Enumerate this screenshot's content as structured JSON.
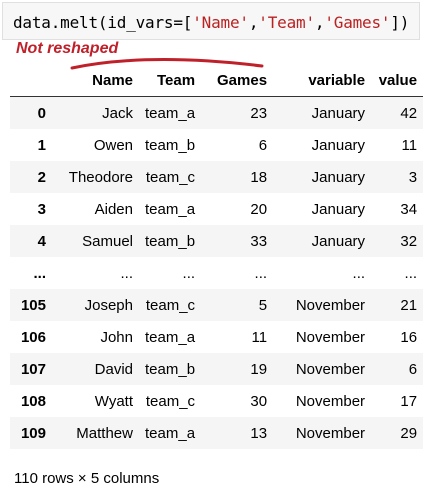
{
  "code": {
    "prefix": "data.melt(id_vars=[",
    "arg1": "'Name'",
    "arg2": "'Team'",
    "arg3": "'Games'",
    "comma": ",",
    "suffix": "])"
  },
  "annotation": {
    "text": "Not reshaped",
    "color": "#c0202a"
  },
  "table": {
    "columns": [
      "",
      "Name",
      "Team",
      "Games",
      "variable",
      "value"
    ],
    "rows": [
      [
        "0",
        "Jack",
        "team_a",
        "23",
        "January",
        "42"
      ],
      [
        "1",
        "Owen",
        "team_b",
        "6",
        "January",
        "11"
      ],
      [
        "2",
        "Theodore",
        "team_c",
        "18",
        "January",
        "3"
      ],
      [
        "3",
        "Aiden",
        "team_a",
        "20",
        "January",
        "34"
      ],
      [
        "4",
        "Samuel",
        "team_b",
        "33",
        "January",
        "32"
      ],
      [
        "...",
        "...",
        "...",
        "...",
        "...",
        "..."
      ],
      [
        "105",
        "Joseph",
        "team_c",
        "5",
        "November",
        "21"
      ],
      [
        "106",
        "John",
        "team_a",
        "11",
        "November",
        "16"
      ],
      [
        "107",
        "David",
        "team_b",
        "19",
        "November",
        "6"
      ],
      [
        "108",
        "Wyatt",
        "team_c",
        "30",
        "November",
        "17"
      ],
      [
        "109",
        "Matthew",
        "team_a",
        "13",
        "November",
        "29"
      ]
    ]
  },
  "footer": "110 rows × 5 columns"
}
